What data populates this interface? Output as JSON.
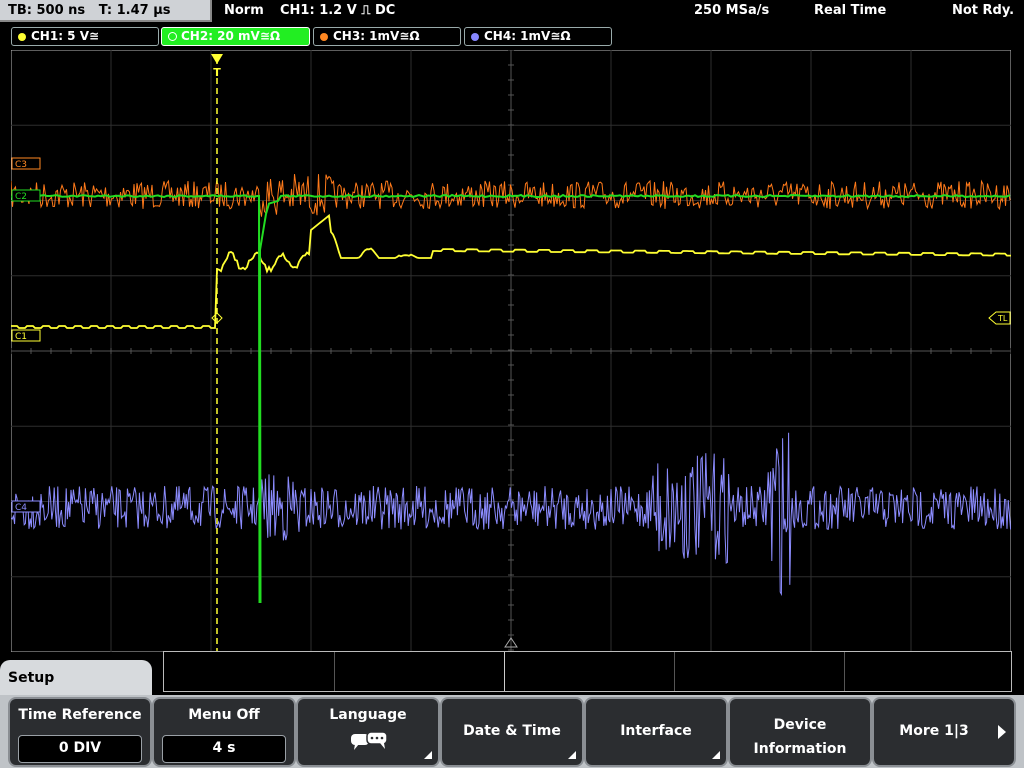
{
  "topbar": {
    "timebase": "TB: 500 ns",
    "trigger_time": "T: 1.47 µs",
    "mode": "Norm",
    "trigger": "CH1: 1.2 V ⎍ DC",
    "sample_rate": "250 MSa/s",
    "acq": "Real Time",
    "status": "Not Rdy."
  },
  "channels": [
    {
      "label": "CH1: 5 V≅",
      "color": "#ffff33"
    },
    {
      "label": "CH2: 20 mV≅Ω",
      "color": "#33dd33"
    },
    {
      "label": "CH3: 1mV≅Ω",
      "color": "#ff8822"
    },
    {
      "label": "CH4: 1mV≅Ω",
      "color": "#8888ff"
    }
  ],
  "markers": {
    "c3": "C3",
    "c2": "C2",
    "c1": "C1",
    "c4": "C4",
    "trigger_level": "TL",
    "trigger_pos": "T"
  },
  "setup": {
    "title": "Setup"
  },
  "softkeys": {
    "time_reference": {
      "label": "Time Reference",
      "value": "0 DIV"
    },
    "menu_off": {
      "label": "Menu Off",
      "value": "4 s"
    },
    "language": {
      "label": "Language",
      "icon": "speech-bubble-icon"
    },
    "date_time": {
      "label": "Date & Time"
    },
    "interface": {
      "label": "Interface"
    },
    "device_info": {
      "label_line1": "Device",
      "label_line2": "Information"
    },
    "more": {
      "label": "More 1|3"
    }
  }
}
